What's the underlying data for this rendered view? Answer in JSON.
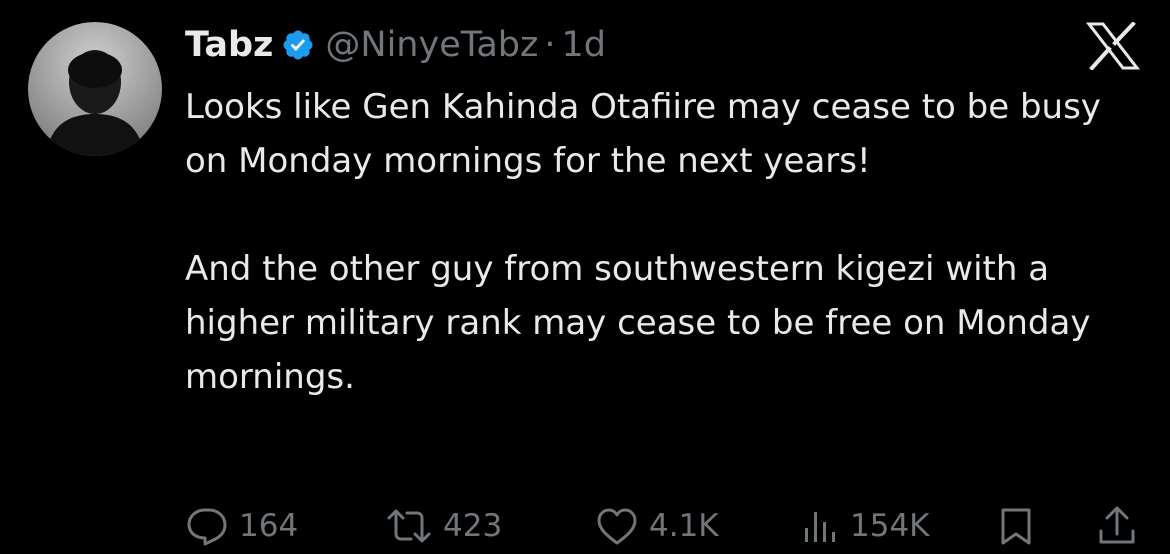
{
  "tweet": {
    "author": {
      "name": "Tabz",
      "handle": "@NinyeTabz",
      "verified": true,
      "avatar": "profile-photo"
    },
    "separator": "·",
    "timestamp": "1d",
    "platform_icon": "x-logo-icon",
    "text": [
      "Looks like Gen Kahinda Otafiire may cease to be busy on Monday mornings for the next years!",
      "And the other guy from southwestern kigezi with a higher military rank may cease to be free on Monday mornings."
    ],
    "metrics": {
      "replies": "164",
      "reposts": "423",
      "likes": "4.1K",
      "views": "154K"
    },
    "icons": {
      "reply": "reply-icon",
      "repost": "repost-icon",
      "like": "heart-icon",
      "views": "views-icon",
      "bookmark": "bookmark-icon",
      "share": "share-icon"
    }
  },
  "colors": {
    "background": "#000000",
    "text": "#e7e9ea",
    "secondary": "#71767b",
    "verified_blue": "#1d9bf0"
  }
}
